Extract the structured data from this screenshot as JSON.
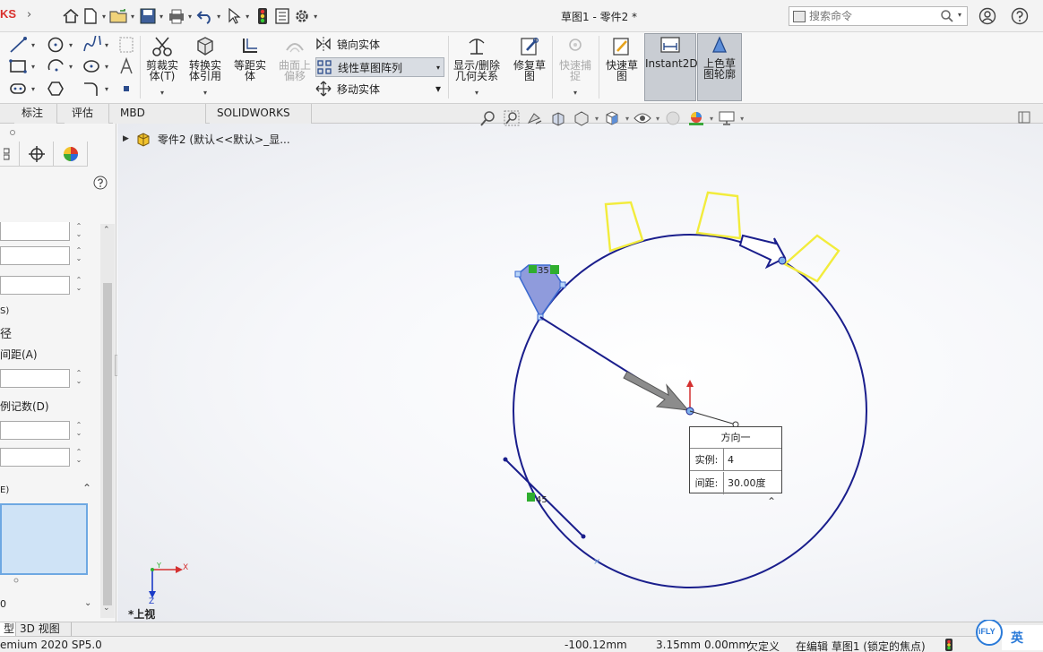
{
  "app": {
    "brand": "KS",
    "doc_title": "草图1 - 零件2 *"
  },
  "search": {
    "placeholder": "搜索命令"
  },
  "ribbon": {
    "trim": "剪裁实\n体(T)",
    "convert": "转换实\n体引用",
    "offset": "等距实\n体",
    "surface_offset": "曲面上\n偏移",
    "mirror": "镜向实体",
    "linear_pattern": "线性草图阵列",
    "move": "移动实体",
    "show_delete_relations": "显示/删除\n几何关系",
    "repair_sketch": "修复草\n图",
    "quick_snap": "快速捕\n捉",
    "rapid_sketch": "快速草\n图",
    "instant2d": "Instant2D",
    "shaded_contours": "上色草\n图轮廓"
  },
  "tabs": [
    "标注",
    "评估",
    "MBD Dimensions",
    "SOLIDWORKS 插件"
  ],
  "left_panel": {
    "label_s": "S)",
    "label_radius": "径",
    "label_spacing": "间距(A)",
    "label_instances": "例记数(D)",
    "label_e": "E)",
    "label_bottom": "0"
  },
  "tree": {
    "part_label": "零件2 (默认<<默认>_显..."
  },
  "dimension": {
    "title": "方向一",
    "instances_label": "实例:",
    "instances_value": "4",
    "spacing_label": "间距:",
    "spacing_value": "30.00度"
  },
  "sketch_labels": {
    "label_top": "35",
    "label_bottom": "45"
  },
  "triad": {
    "x": "X",
    "y": "Y",
    "z": "Z"
  },
  "view": {
    "name": "*上视"
  },
  "bottom_tabs": [
    "型",
    "3D 视图"
  ],
  "status": {
    "version": "emium 2020 SP5.0",
    "x": "-100.12mm",
    "y": "3.15mm",
    "z": "0.00mm",
    "defined": "欠定义",
    "editing": "在编辑 草图1 (锁定的焦点)"
  },
  "ime": {
    "label": "英",
    "brand": "iFLY"
  },
  "colors": {
    "sketch_blue": "#1a1e8c",
    "pattern_yellow": "#f2ec3c",
    "selection_fill": "#8f9bdc",
    "relation_green": "#2fae2f"
  }
}
